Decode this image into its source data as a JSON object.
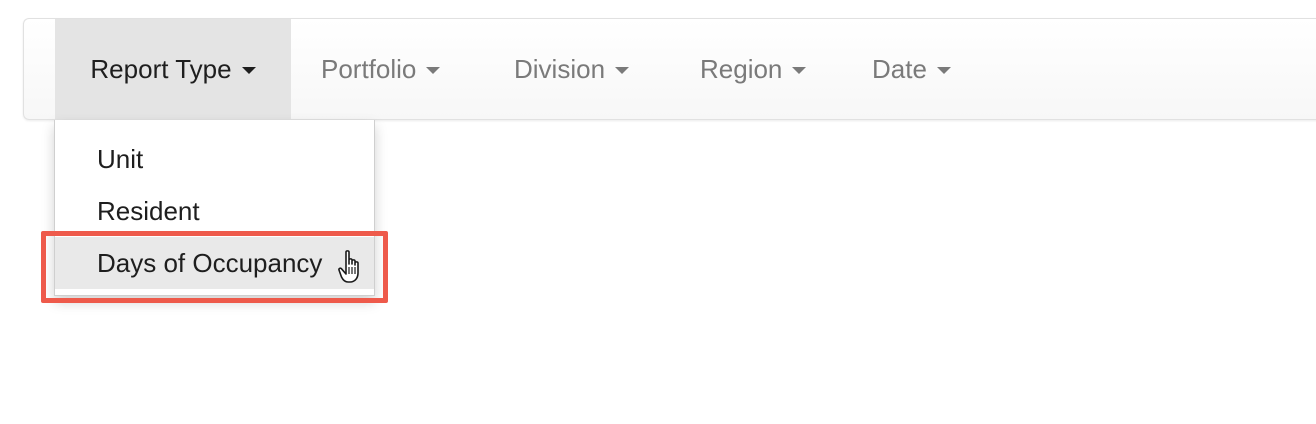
{
  "navbar": {
    "items": [
      {
        "label": "Report Type",
        "active": true
      },
      {
        "label": "Portfolio",
        "active": false
      },
      {
        "label": "Division",
        "active": false
      },
      {
        "label": "Region",
        "active": false
      },
      {
        "label": "Date",
        "active": false
      }
    ]
  },
  "dropdown": {
    "items": [
      {
        "label": "Unit"
      },
      {
        "label": "Resident"
      },
      {
        "label": "Days of Occupancy",
        "hovered": true
      }
    ]
  },
  "annotation": {
    "highlight_color": "#ee5a4b",
    "cursor_icon": "hand-pointer-icon"
  }
}
